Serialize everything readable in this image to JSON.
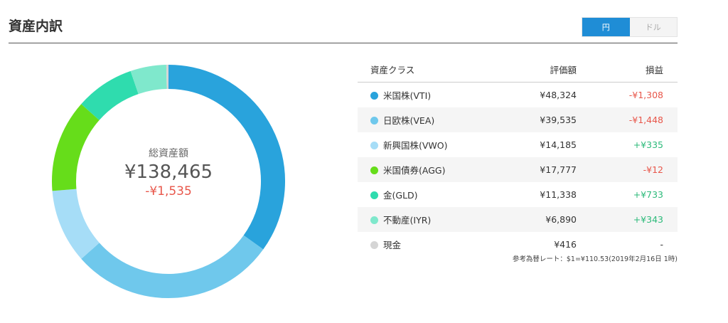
{
  "title": "資産内訳",
  "toggle": {
    "yen": "円",
    "dollar": "ドル"
  },
  "summary": {
    "label": "総資産額",
    "total": "¥138,465",
    "pl": "-¥1,535"
  },
  "table": {
    "headers": [
      "資産クラス",
      "評価額",
      "損益"
    ],
    "rows": [
      {
        "name": "米国株(VTI)",
        "value": "¥48,324",
        "pl": "-¥1,308",
        "trend": "neg",
        "color": "#29a3dc",
        "amount": 48324
      },
      {
        "name": "日欧株(VEA)",
        "value": "¥39,535",
        "pl": "-¥1,448",
        "trend": "neg",
        "color": "#6fc8ec",
        "amount": 39535
      },
      {
        "name": "新興国株(VWO)",
        "value": "¥14,185",
        "pl": "+¥335",
        "trend": "pos",
        "color": "#a6ddf7",
        "amount": 14185
      },
      {
        "name": "米国債券(AGG)",
        "value": "¥17,777",
        "pl": "-¥12",
        "trend": "neg",
        "color": "#66dd1a",
        "amount": 17777
      },
      {
        "name": "金(GLD)",
        "value": "¥11,338",
        "pl": "+¥733",
        "trend": "pos",
        "color": "#2fdcae",
        "amount": 11338
      },
      {
        "name": "不動産(IYR)",
        "value": "¥6,890",
        "pl": "+¥343",
        "trend": "pos",
        "color": "#7fe8cc",
        "amount": 6890
      },
      {
        "name": "現金",
        "value": "¥416",
        "pl": "-",
        "trend": "none",
        "color": "#d5d5d5",
        "amount": 416
      }
    ]
  },
  "note": "参考為替レート：$1=¥110.53(2019年2月16日 1時)"
}
